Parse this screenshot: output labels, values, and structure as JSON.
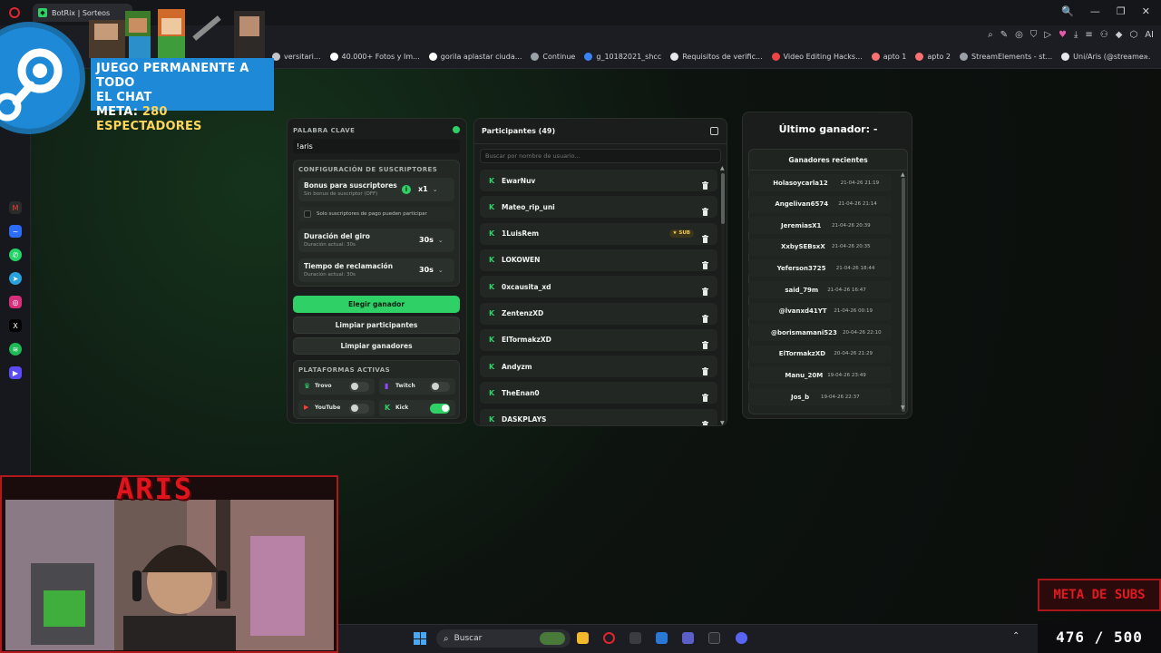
{
  "browser": {
    "tab_title": "BotRix | Sorteos",
    "window_controls": [
      "🔍",
      "—",
      "❐",
      "✕"
    ],
    "address_tools": [
      "⌕",
      "✎",
      "◎",
      "⛉",
      "▷",
      "♥",
      "⤓",
      "≡",
      "⚇",
      "◆",
      "⬡",
      "AI"
    ],
    "bookmarks": [
      {
        "label": "versitari...",
        "color": "#c2c6cc"
      },
      {
        "label": "40.000+ Fotos y Im...",
        "color": "#ffffff"
      },
      {
        "label": "gorila aplastar ciuda...",
        "color": "#ffffff"
      },
      {
        "label": "Continue",
        "color": "#9aa0a8"
      },
      {
        "label": "g_10182021_shcc",
        "color": "#3b82f6"
      },
      {
        "label": "Requisitos de verific...",
        "color": "#e5e7eb"
      },
      {
        "label": "Video Editing Hacks...",
        "color": "#ef4444"
      },
      {
        "label": "apto 1",
        "color": "#f87171"
      },
      {
        "label": "apto 2",
        "color": "#f87171"
      },
      {
        "label": "StreamElements - st...",
        "color": "#9aa0a8"
      },
      {
        "label": "Uni/Aris (@streame...",
        "color": "#e5e7eb"
      }
    ]
  },
  "overlay": {
    "banner_line1": "JUEGO PERMANENTE A TODO",
    "banner_line2": "EL CHAT",
    "banner_meta_label": "META:",
    "banner_meta_value": "280 ESPECTADORES",
    "cam_name": "ARIS",
    "subs_goal_label": "META DE SUBS",
    "subs_goal_value": "476 / 500"
  },
  "settings": {
    "keyword_label": "PALABRA CLAVE",
    "keyword_value": "!aris",
    "subs_config_label": "CONFIGURACIÓN DE SUSCRIPTORES",
    "bonus_title": "Bonus para suscriptores",
    "bonus_sub": "Sin bonus de suscriptor (OFF)",
    "bonus_value": "x1",
    "paid_only_label": "Solo suscriptores de pago pueden participar",
    "spin_title": "Duración del giro",
    "spin_sub": "Duración actual: 30s",
    "spin_value": "30s",
    "claim_title": "Tiempo de reclamación",
    "claim_sub": "Duración actual: 30s",
    "claim_value": "30s",
    "pick_winner": "Elegir ganador",
    "clear_participants": "Limpiar participantes",
    "clear_winners": "Limpiar ganadores",
    "platforms_label": "PLATAFORMAS ACTIVAS",
    "platforms": {
      "trovo": {
        "label": "Trovo",
        "enabled": false
      },
      "twitch": {
        "label": "Twitch",
        "enabled": false
      },
      "youtube": {
        "label": "YouTube",
        "enabled": false
      },
      "kick": {
        "label": "Kick",
        "enabled": true
      }
    }
  },
  "participants": {
    "title": "Participantes (49)",
    "search_placeholder": "Buscar por nombre de usuario...",
    "sub_badge": "★ SUB",
    "items": [
      "EwarNuv",
      "Mateo_rip_uni",
      "1LuisRem",
      "LOKOWEN",
      "0xcausita_xd",
      "ZentenzXD",
      "ElTormakzXD",
      "Andyzm",
      "TheEnan0",
      "DASKPLAYS"
    ]
  },
  "winners": {
    "last_winner": "Último ganador: -",
    "recent_title": "Ganadores recientes",
    "items": [
      {
        "name": "Holasoycarla12",
        "date": "21-04-26 21:19"
      },
      {
        "name": "Angelivan6574",
        "date": "21-04-26 21:14"
      },
      {
        "name": "JeremiasX1",
        "date": "21-04-26 20:39"
      },
      {
        "name": "XxbySEBsxX",
        "date": "21-04-26 20:35"
      },
      {
        "name": "Yeferson3725",
        "date": "21-04-26 18:44"
      },
      {
        "name": "said_79m",
        "date": "21-04-26 16:47"
      },
      {
        "name": "@lvanxd41YT",
        "date": "21-04-26 00:19"
      },
      {
        "name": "@borismamani523",
        "date": "20-04-26 22:10"
      },
      {
        "name": "ElTormakzXD",
        "date": "20-04-26 21:29"
      },
      {
        "name": "Manu_20M",
        "date": "19-04-26 23:49"
      },
      {
        "name": "Jos_b",
        "date": "19-04-26 22:37"
      }
    ]
  },
  "taskbar": {
    "search_label": "Buscar"
  }
}
